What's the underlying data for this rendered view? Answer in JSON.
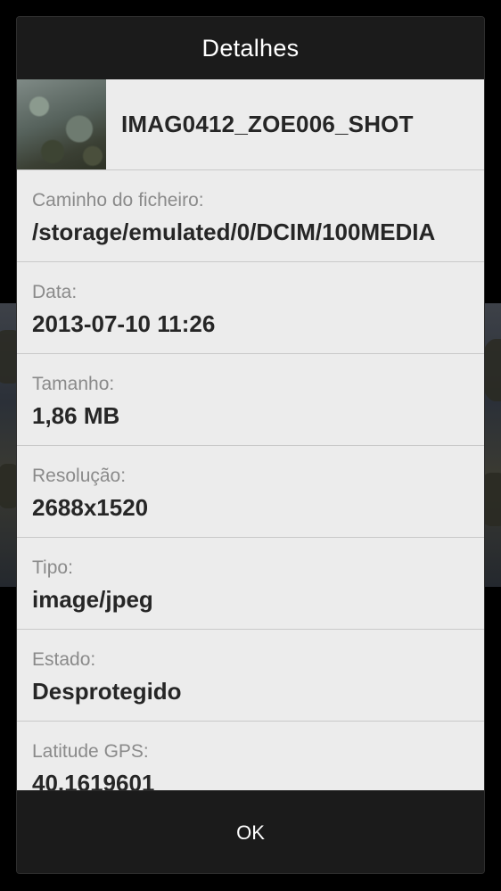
{
  "dialog": {
    "title": "Detalhes",
    "file_name": "IMAG0412_ZOE006_SHOT",
    "thumbnail_icon": "photo-thumbnail",
    "rows": [
      {
        "label": "Caminho do ficheiro:",
        "value": "/storage/emulated/0/DCIM/100MEDIA"
      },
      {
        "label": "Data:",
        "value": "2013-07-10 11:26"
      },
      {
        "label": "Tamanho:",
        "value": "1,86 MB"
      },
      {
        "label": "Resolução:",
        "value": "2688x1520"
      },
      {
        "label": "Tipo:",
        "value": "image/jpeg"
      },
      {
        "label": "Estado:",
        "value": "Desprotegido"
      },
      {
        "label": "Latitude GPS:",
        "value": "40.1619601"
      }
    ],
    "ok_label": "OK"
  },
  "colors": {
    "dialog_bg": "#1b1b1b",
    "content_bg": "#ececec",
    "label_gray": "#8a8a8a",
    "value_dark": "#262626",
    "divider": "#c9c9c9"
  }
}
